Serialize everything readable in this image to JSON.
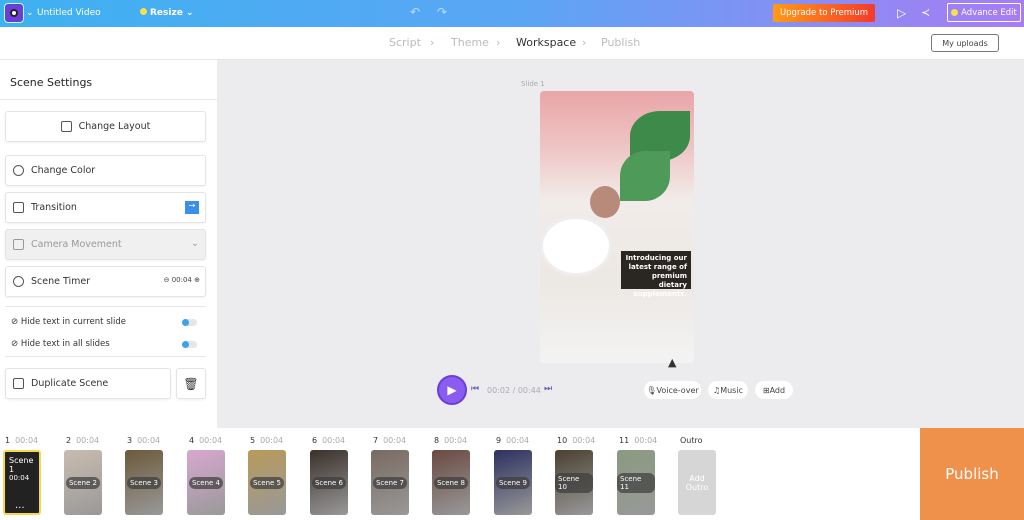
{
  "topbar": {
    "title": "Untitled Video",
    "resize": "Resize",
    "upgrade": "Upgrade to Premium",
    "advance_edit": "Advance Edit"
  },
  "steps": [
    "Script",
    "Theme",
    "Workspace",
    "Publish"
  ],
  "active_step": "Workspace",
  "my_uploads": "My uploads",
  "panel": {
    "title": "Scene Settings",
    "change_layout": "Change Layout",
    "change_color": "Change Color",
    "transition": "Transition",
    "camera_movement": "Camera Movement",
    "scene_timer": "Scene Timer",
    "timer_value": "00:04",
    "hide_current": "Hide text in current slide",
    "hide_all": "Hide text in all slides",
    "duplicate": "Duplicate Scene"
  },
  "canvas": {
    "slide_label": "Slide 1",
    "caption": "Introducing our latest range of premium dietary supplements.",
    "time": "00:02 / 00:44",
    "voiceover": "Voice-over",
    "music": "Music",
    "add": "Add"
  },
  "scenes": [
    {
      "num": "1",
      "dur": "00:04",
      "label": "Scene 1",
      "color": "#2a2a2a"
    },
    {
      "num": "2",
      "dur": "00:04",
      "label": "Scene 2",
      "color": "#c9bcb0"
    },
    {
      "num": "3",
      "dur": "00:04",
      "label": "Scene 3",
      "color": "#6c5a3a"
    },
    {
      "num": "4",
      "dur": "00:04",
      "label": "Scene 4",
      "color": "#d8a8d0"
    },
    {
      "num": "5",
      "dur": "00:04",
      "label": "Scene 5",
      "color": "#b89a5a"
    },
    {
      "num": "6",
      "dur": "00:04",
      "label": "Scene 6",
      "color": "#3a302a"
    },
    {
      "num": "7",
      "dur": "00:04",
      "label": "Scene 7",
      "color": "#7a6a60"
    },
    {
      "num": "8",
      "dur": "00:04",
      "label": "Scene 8",
      "color": "#6a4a40"
    },
    {
      "num": "9",
      "dur": "00:04",
      "label": "Scene 9",
      "color": "#2c3060"
    },
    {
      "num": "10",
      "dur": "00:04",
      "label": "Scene 10",
      "color": "#4a4030"
    },
    {
      "num": "11",
      "dur": "00:04",
      "label": "Scene 11",
      "color": "#8a9a80"
    }
  ],
  "outro": {
    "label": "Outro",
    "add": "Add Outro"
  },
  "scene1_more": "...",
  "publish": "Publish"
}
